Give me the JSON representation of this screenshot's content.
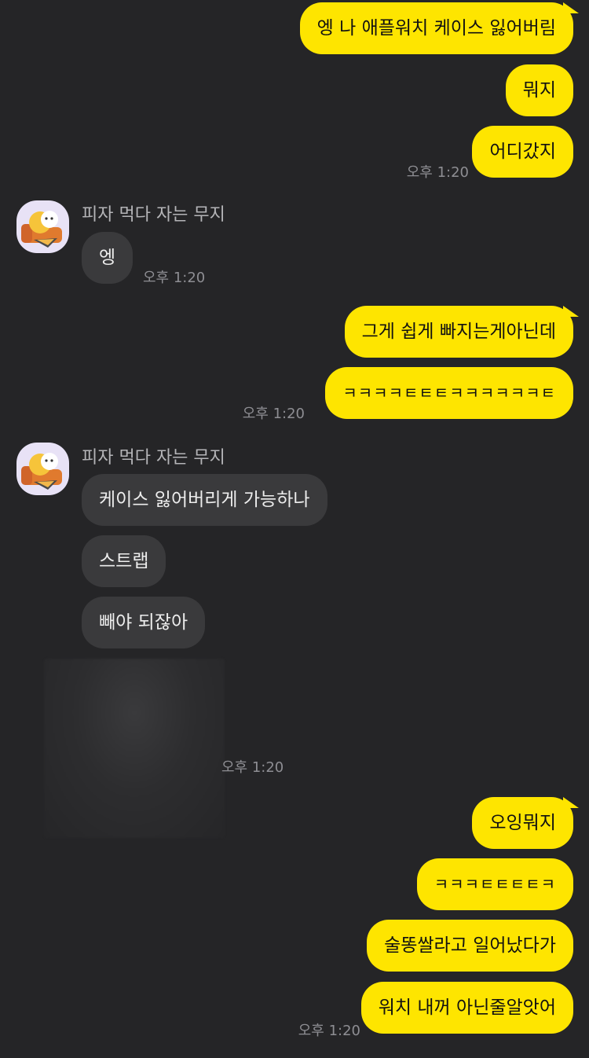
{
  "colors": {
    "background": "#252527",
    "outgoing_bubble": "#FEE500",
    "incoming_bubble": "#3A3A3C",
    "timestamp": "#8E8E93"
  },
  "sender": {
    "name": "피자 먹다 자는 무지",
    "avatar_icon": "muzi-pizza-avatar-icon"
  },
  "messages": {
    "m1": "엥 나 애플워치 케이스 잃어버림",
    "m2": "뭐지",
    "m3": "어디갔지",
    "t1": "오후 1:20",
    "m4": "엥",
    "t2": "오후 1:20",
    "m5": "그게 쉽게 빠지는게아닌데",
    "m6": "ㅋㅋㅋㅋㅌㅌㅌㅋㅋㅋㅋㅋㅋㅌ",
    "t3": "오후 1:20",
    "m7": "케이스 잃어버리게 가능하나",
    "m8": "스트랩",
    "m9": "빼야 되잖아",
    "t4": "오후 1:20",
    "m10": "오잉뭐지",
    "m11": "ㅋㅋㅋㅌㅌㅌㅌㅋ",
    "m12": "술똥쌀라고 일어났다가",
    "m13": "워치 내꺼 아닌줄알앗어",
    "t5": "오후 1:20"
  }
}
